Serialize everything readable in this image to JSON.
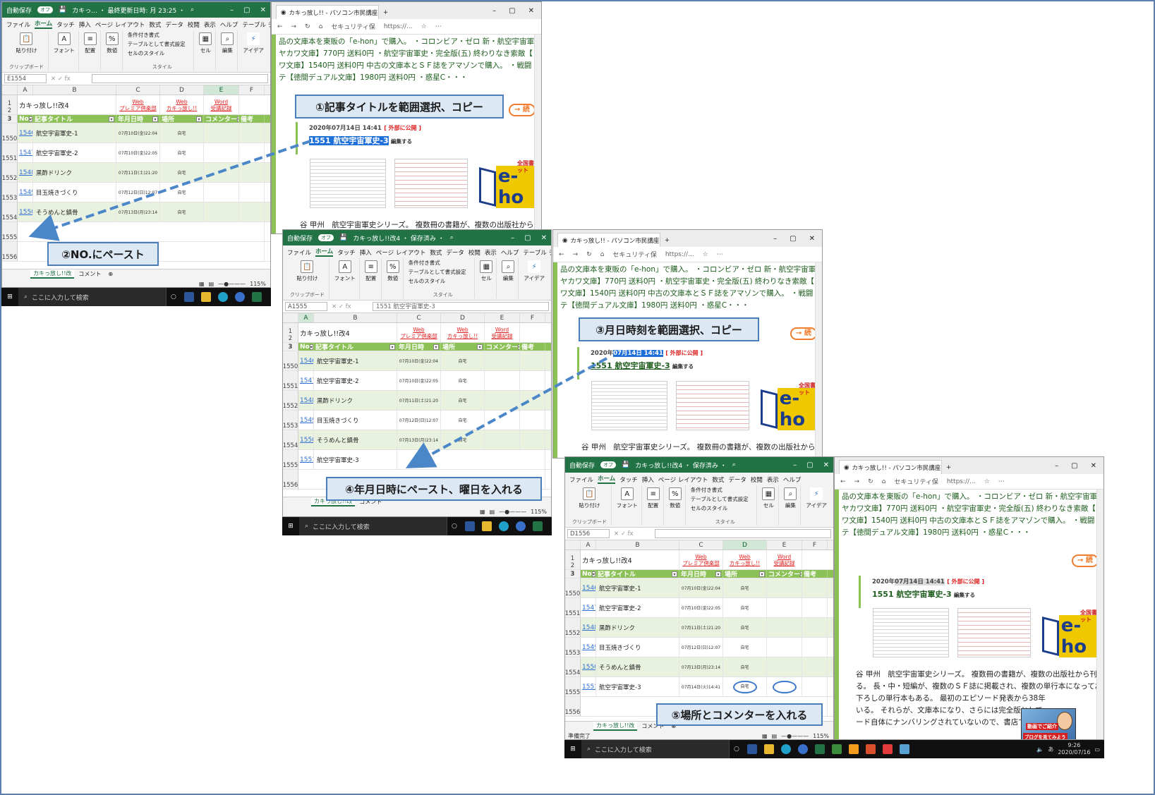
{
  "excel": {
    "autosave": "自動保存",
    "autosave_toggle": "オフ",
    "titles": [
      "カキっ... ・ 最終更新日時: 月 23:25 ・",
      "カキっ放し!!改4 ・ 保存済み ・",
      "カキっ放し!!改4 ・ 保存済み ・"
    ],
    "tabs": [
      "ファイル",
      "ホーム",
      "タッチ",
      "挿入",
      "ページ レイアウト",
      "数式",
      "データ",
      "校閲",
      "表示",
      "ヘルプ",
      "テーブル デザイン"
    ],
    "ribbon": {
      "paste": "貼り付け",
      "clipboard": "クリップボード",
      "font": "フォント",
      "align": "配置",
      "number": "数値",
      "cond_format": "条件付き書式",
      "table_format": "テーブルとして書式設定",
      "cell_style": "セルのスタイル",
      "styles": "スタイル",
      "cells": "セル",
      "edit": "編集",
      "ideas": "アイデア"
    },
    "name_boxes": [
      "E1554",
      "A1555",
      "D1556"
    ],
    "formula_values": [
      "",
      "1551 航空宇宙軍史-3",
      ""
    ],
    "columns": [
      "A",
      "B",
      "C",
      "D",
      "E",
      "F"
    ],
    "sheet_title": "カキっ放し!!改4",
    "links": [
      {
        "top": "Web",
        "bottom": "プレミア倶楽部"
      },
      {
        "top": "Web",
        "bottom": "カキっ放し!!"
      },
      {
        "top": "Word",
        "bottom": "受講記録"
      }
    ],
    "headers": [
      "No",
      "記事タイトル",
      "年月日時",
      "場所",
      "コメンター",
      "備考"
    ],
    "rows": [
      {
        "rownum": "1550",
        "no": "1546",
        "title": "航空宇宙軍史-1",
        "date": "07月10日(金)22:04",
        "place": "自宅"
      },
      {
        "rownum": "1551",
        "no": "1547",
        "title": "航空宇宙軍史-2",
        "date": "07月10日(金)22:05",
        "place": "自宅"
      },
      {
        "rownum": "1552",
        "no": "1548",
        "title": "黒酢ドリンク",
        "date": "07月11日(土)21:20",
        "place": "自宅"
      },
      {
        "rownum": "1553",
        "no": "1549",
        "title": "目玉焼きづくり",
        "date": "07月12日(日)12:07",
        "place": "自宅"
      },
      {
        "rownum": "1554",
        "no": "1550",
        "title": "そうめんと鎮骨",
        "date": "07月13日(月)23:14",
        "place": "自宅"
      }
    ],
    "new_row": {
      "rownum": "1555",
      "no": "1551",
      "title": "航空宇宙軍史-3",
      "date": "07月14日(火)14:41",
      "place": "自宅"
    },
    "last_row": "1556",
    "sheet_tabs": [
      "カキっ放し!!改",
      "コメント"
    ],
    "status_ready": "準備完了",
    "zoom": "115%"
  },
  "browser": {
    "tab_title": "カキっ放し!! - パソコン市民講座プレ",
    "security": "セキュリティ保",
    "url": "https://...",
    "lines": [
      "品の文庫本を東販の「e-hon」で購入。 ・コロンビア・ゼロ 新・航空宇宙軍",
      "ヤカワ文庫】770円 送料0円 ・航空宇宙軍史・完全版(五) 終わりなき索敵【",
      "ワ文庫】1540円 送料0円 中古の文庫本とＳＦ誌をアマゾンで購入。 ・戦闘",
      "テ【徳間デュアル文庫】1980円 送料0円 ・惑星C・・・"
    ],
    "next_btn": "→ 続",
    "date_prefix": "2020年",
    "date_sel": "07月14日 14:41",
    "public": "[ 外部に公開 ]",
    "post_no": "1551",
    "post_title": "航空宇宙軍史-3",
    "edit": "編集する",
    "ehon_text": "全国書店ネット",
    "body_line": "谷 甲州　航空宇宙軍史シリーズ。 複数冊の書籍が、複数の出版社から刊行さ",
    "body_more": [
      "る。 長・中・短編が、複数のＳＦ誌に掲載され、複数の単行本になっており",
      "下ろしの単行本もある。 最初のエピソード発表から38年",
      "いる。 それらが、文庫本になり、さらには完全版として",
      "ード自体にナンバリングされていないので、書店で"
    ]
  },
  "taskbar": {
    "search": "ここに入力して検索",
    "time": "9:26",
    "date": "2020/07/16",
    "ime": "あ"
  },
  "callouts": [
    "①記事タイトルを範囲選択、コピー",
    "②NO.にペースト",
    "③月日時刻を範囲選択、コピー",
    "④年月日時にペースト、曜日を入れる",
    "⑤場所とコメンターを入れる"
  ],
  "avatar": {
    "line1": "動画でご紹介",
    "line2": "ブログを見てみよう"
  }
}
